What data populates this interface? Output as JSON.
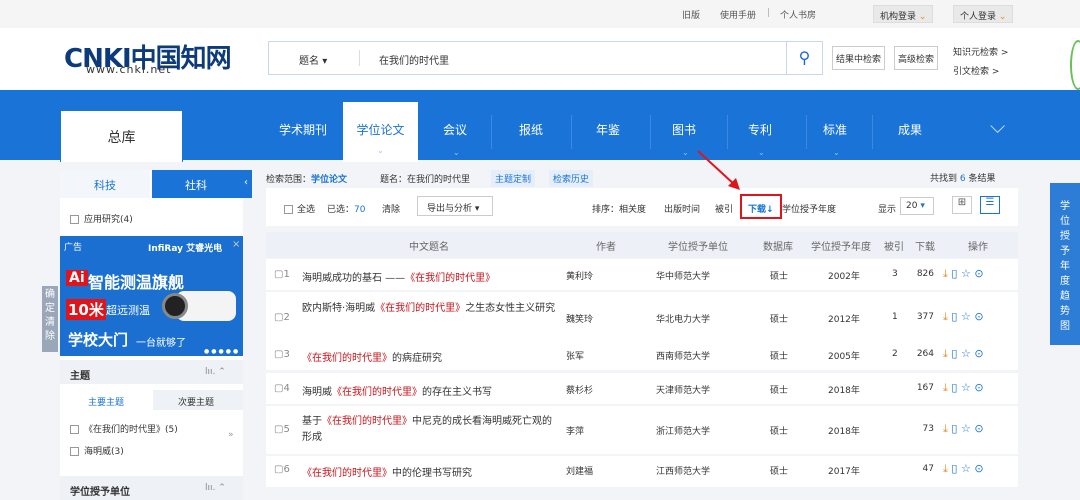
{
  "topbar": {
    "links": [
      "旧版",
      "使用手册",
      "个人书房"
    ],
    "org_login": "机构登录",
    "personal_login": "个人登录"
  },
  "logo": {
    "text": "CNKI中国知网",
    "sub": "www.cnki.net"
  },
  "search": {
    "field": "题名",
    "value": "在我们的时代里",
    "btn_in_results": "结果中检索",
    "btn_advanced": "高级检索",
    "link_knowledge": "知识元检索",
    "link_citation": "引文检索"
  },
  "nav": {
    "home": "总库",
    "items": [
      "学术期刊",
      "学位论文",
      "会议",
      "报纸",
      "年鉴",
      "图书",
      "专利",
      "标准",
      "成果"
    ],
    "active": "学位论文"
  },
  "sidebar": {
    "tabs": [
      "科技",
      "社科"
    ],
    "applied": "应用研究(4)",
    "ad_label": "广告",
    "ad_brand": "InfiRay 艾睿光电",
    "ad_line1": "智能测温旗舰",
    "ad_line2a": "10米",
    "ad_line2b": "超远测温",
    "ad_line3a": "学校大门",
    "ad_line3b": "一台就够了",
    "side_btns": [
      "确定",
      "清除"
    ],
    "topic_title": "主题",
    "topic_tabs": [
      "主要主题",
      "次要主题"
    ],
    "topics": [
      "《在我们的时代里》(5)",
      "海明威(3)"
    ],
    "unit_title": "学位授予单位"
  },
  "results": {
    "scope_label": "检索范围：",
    "scope_value": "学位论文",
    "query_text": "题名：在我们的时代里",
    "btn_subscribe": "主题定制",
    "btn_history": "检索历史",
    "total_prefix": "共找到",
    "total": "6",
    "total_suffix": "条结果",
    "select_all": "全选",
    "selected_label": "已选：",
    "selected": "70",
    "clear": "清除",
    "export": "导出与分析",
    "sort_label": "排序：",
    "sort_options": [
      "相关度",
      "出版时间",
      "被引",
      "下载",
      "学位授予年度"
    ],
    "sort_active": "下载",
    "page_size_label": "显示",
    "page_size": "20",
    "headers": [
      "中文题名",
      "作者",
      "学位授予单位",
      "数据库",
      "学位授予年度",
      "被引",
      "下载",
      "操作"
    ],
    "rows": [
      {
        "n": "1",
        "pre": "海明威成功的基石 ——",
        "hl": "《在我们的时代里》",
        "post": "",
        "author": "黄利玲",
        "unit": "华中师范大学",
        "db": "硕士",
        "year": "2002年",
        "cite": "3",
        "dl": "826"
      },
      {
        "n": "2",
        "pre": "欧内斯特·海明威",
        "hl": "《在我们的时代里》",
        "post": "之生态女性主义研究",
        "author": "魏笑玲",
        "unit": "华北电力大学",
        "db": "硕士",
        "year": "2012年",
        "cite": "1",
        "dl": "377"
      },
      {
        "n": "3",
        "pre": "",
        "hl": "《在我们的时代里》",
        "post": "的病症研究",
        "author": "张军",
        "unit": "西南师范大学",
        "db": "硕士",
        "year": "2005年",
        "cite": "2",
        "dl": "264"
      },
      {
        "n": "4",
        "pre": "海明威",
        "hl": "《在我们的时代里》",
        "post": "的存在主义书写",
        "author": "蔡杉杉",
        "unit": "天津师范大学",
        "db": "硕士",
        "year": "2018年",
        "cite": "",
        "dl": "167"
      },
      {
        "n": "5",
        "pre": "基于",
        "hl": "《在我们的时代里》",
        "post": "中尼克的成长看海明威死亡观的形成",
        "author": "李萍",
        "unit": "浙江师范大学",
        "db": "硕士",
        "year": "2018年",
        "cite": "",
        "dl": "73"
      },
      {
        "n": "6",
        "pre": "",
        "hl": "《在我们的时代里》",
        "post": "中的伦理书写研究",
        "author": "刘建福",
        "unit": "江西师范大学",
        "db": "硕士",
        "year": "2017年",
        "cite": "",
        "dl": "47"
      }
    ]
  },
  "right_panel": "学位授予年度趋势图",
  "colors": {
    "brand_blue": "#1a74d8",
    "highlight_red": "#c8141a",
    "annotation_red": "#e0151c",
    "orange": "#e58a1f"
  }
}
